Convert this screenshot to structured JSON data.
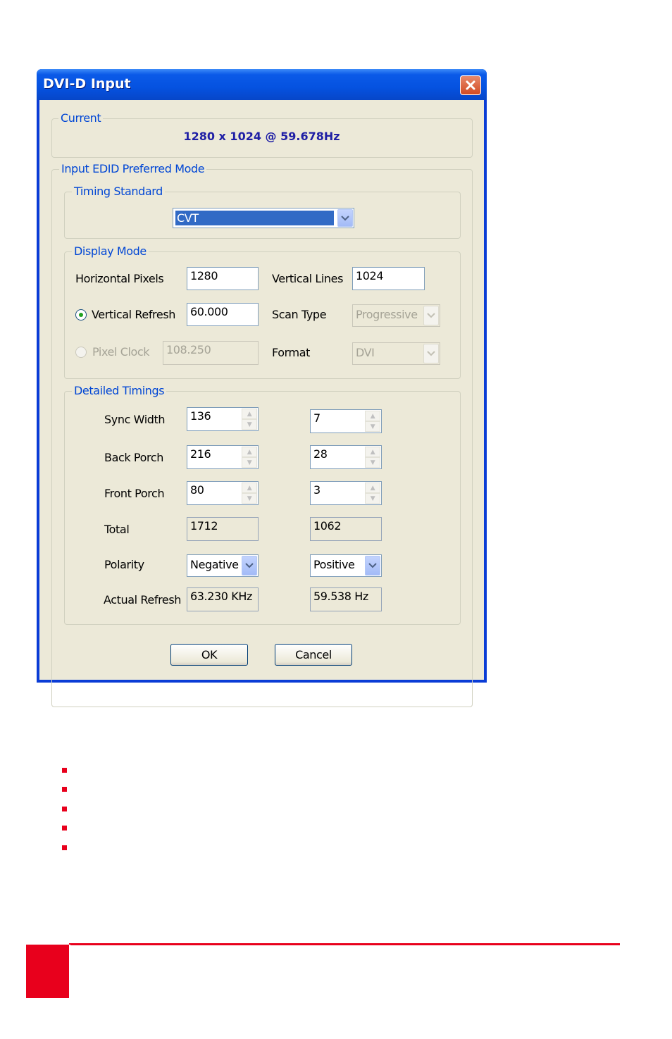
{
  "window": {
    "title": "DVI-D Input"
  },
  "current": {
    "legend": "Current",
    "value": "1280 x 1024 @ 59.678Hz"
  },
  "edid": {
    "legend": "Input EDID Preferred Mode",
    "timing_standard": {
      "legend": "Timing Standard",
      "selected": "CVT"
    },
    "display_mode": {
      "legend": "Display Mode",
      "horizontal_pixels_label": "Horizontal Pixels",
      "horizontal_pixels_value": "1280",
      "vertical_lines_label": "Vertical Lines",
      "vertical_lines_value": "1024",
      "vertical_refresh_label": "Vertical Refresh",
      "vertical_refresh_value": "60.000",
      "scan_type_label": "Scan Type",
      "scan_type_value": "Progressive",
      "pixel_clock_label": "Pixel Clock",
      "pixel_clock_value": "108.250",
      "format_label": "Format",
      "format_value": "DVI"
    },
    "detailed_timings": {
      "legend": "Detailed Timings",
      "sync_width_label": "Sync Width",
      "sync_width_h": "136",
      "sync_width_v": "7",
      "back_porch_label": "Back Porch",
      "back_porch_h": "216",
      "back_porch_v": "28",
      "front_porch_label": "Front Porch",
      "front_porch_h": "80",
      "front_porch_v": "3",
      "total_label": "Total",
      "total_h": "1712",
      "total_v": "1062",
      "polarity_label": "Polarity",
      "polarity_h": "Negative",
      "polarity_v": "Positive",
      "actual_refresh_label": "Actual Refresh",
      "actual_refresh_h": "63.230 KHz",
      "actual_refresh_v": "59.538 Hz"
    }
  },
  "buttons": {
    "ok": "OK",
    "cancel": "Cancel"
  },
  "colors": {
    "accent_red": "#e8001c",
    "title_blue": "#0552e0",
    "legend_blue": "#0046d5",
    "dialog_bg": "#ece9d8"
  }
}
